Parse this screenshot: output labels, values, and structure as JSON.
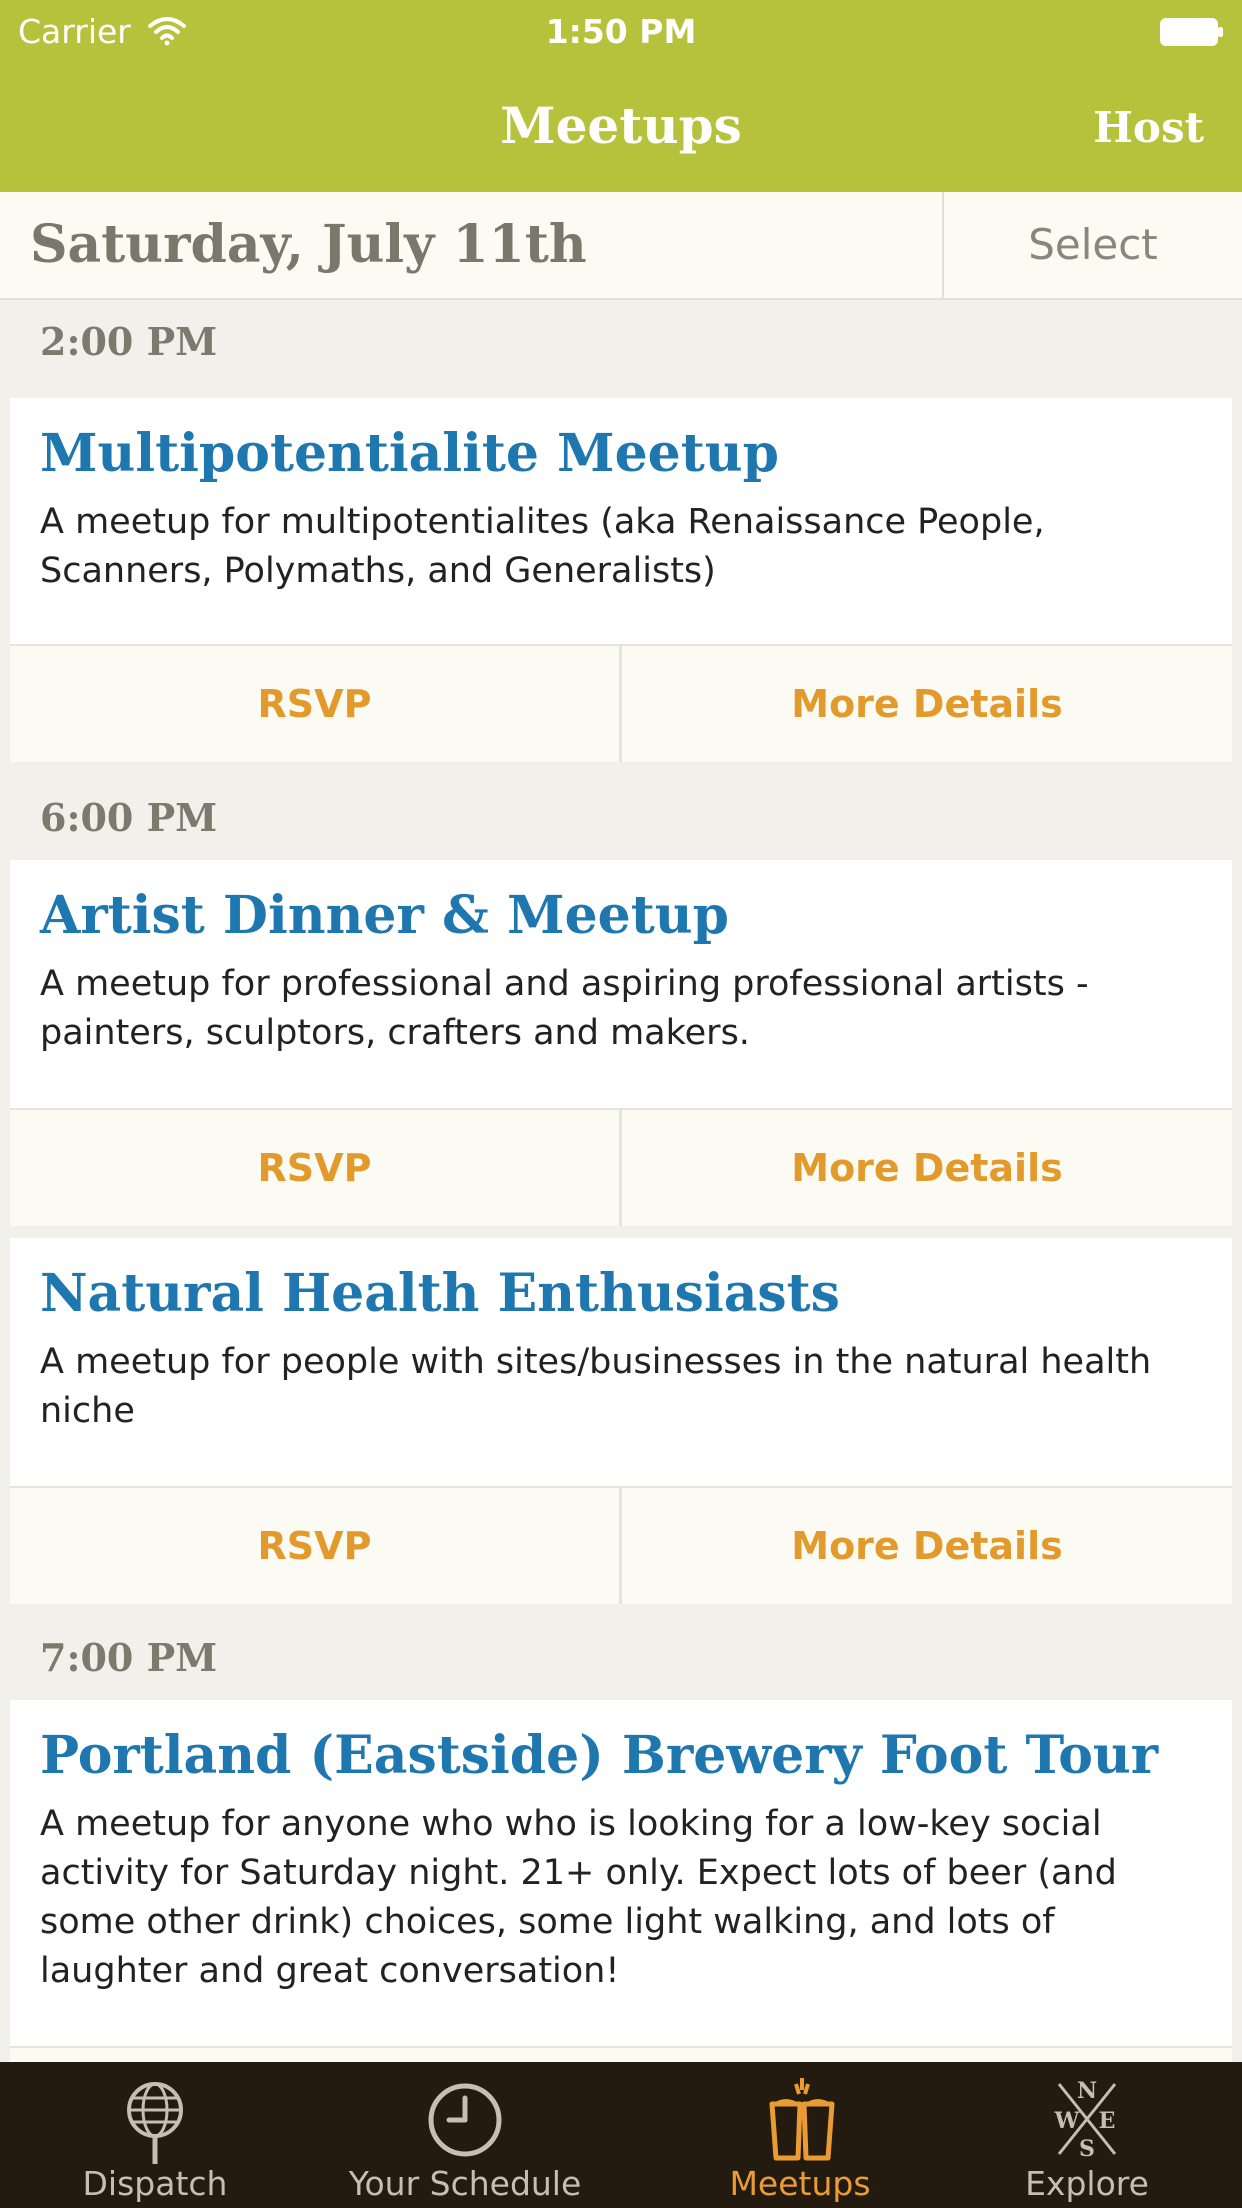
{
  "status_bar": {
    "carrier": "Carrier",
    "time": "1:50 PM"
  },
  "nav": {
    "title": "Meetups",
    "host_label": "Host"
  },
  "date_header": {
    "date": "Saturday, July 11th",
    "select_label": "Select"
  },
  "sections": [
    {
      "time": "2:00 PM",
      "meetups": [
        {
          "title": "Multipotentialite Meetup",
          "description": "A meetup for multipotentialites (aka Renaissance People, Scanners, Polymaths, and Generalists)",
          "rsvp_label": "RSVP",
          "details_label": "More Details"
        }
      ]
    },
    {
      "time": "6:00 PM",
      "meetups": [
        {
          "title": "Artist Dinner & Meetup",
          "description": "A meetup for professional and aspiring professional artists - painters, sculptors, crafters and makers.",
          "rsvp_label": "RSVP",
          "details_label": "More Details"
        },
        {
          "title": "Natural Health Enthusiasts",
          "description": "A meetup for people with sites/businesses in the natural health niche",
          "rsvp_label": "RSVP",
          "details_label": "More Details"
        }
      ]
    },
    {
      "time": "7:00 PM",
      "meetups": [
        {
          "title": "Portland (Eastside) Brewery Foot Tour",
          "description": "A meetup for anyone who who is looking for a low-key social activity for Saturday night. 21+ only.  Expect lots of beer (and some other drink) choices, some light walking, and lots of laughter and great conversation!"
        }
      ]
    }
  ],
  "tab_bar": {
    "items": [
      {
        "label": "Dispatch",
        "icon": "globe-icon"
      },
      {
        "label": "Your Schedule",
        "icon": "clock-icon"
      },
      {
        "label": "Meetups",
        "icon": "beer-mugs-icon",
        "active": true
      },
      {
        "label": "Explore",
        "icon": "compass-icon"
      }
    ]
  },
  "colors": {
    "nav_background": "#b6c23c",
    "title_blue": "#1f77b0",
    "action_orange": "#e39a2c",
    "tab_active": "#ea9c33",
    "tabbar_background": "#231a10",
    "page_background": "#f2f0ea"
  }
}
